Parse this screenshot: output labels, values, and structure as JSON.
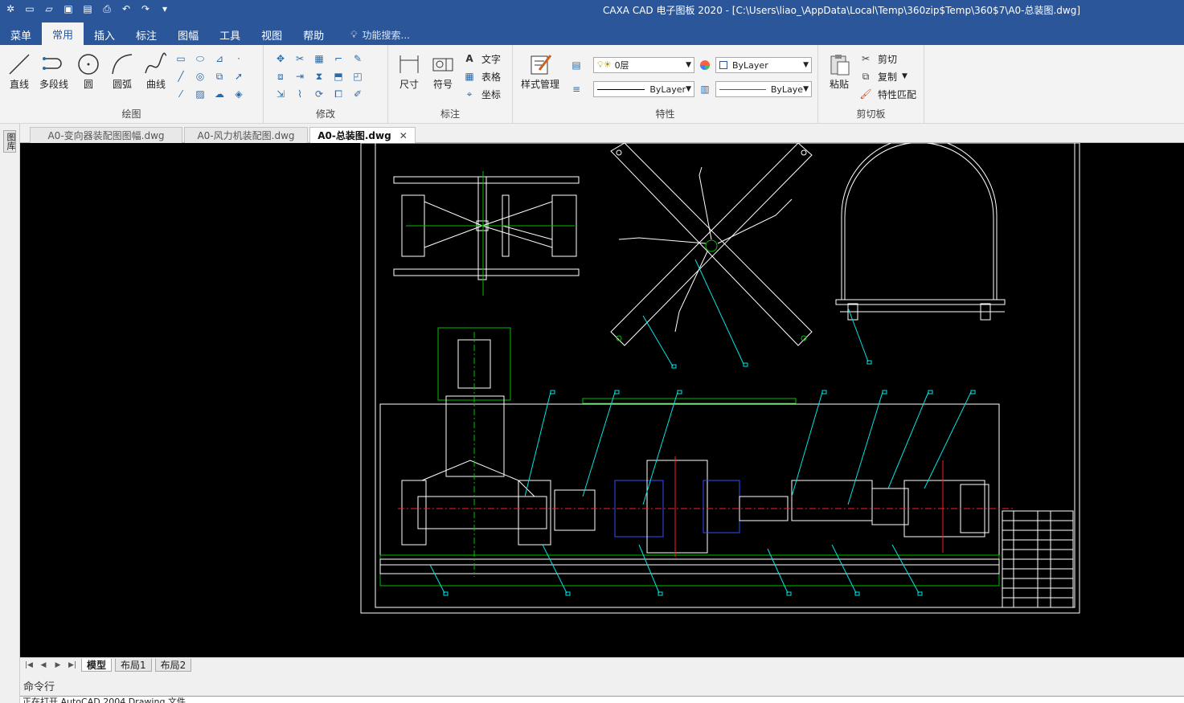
{
  "window": {
    "title": "CAXA CAD 电子图板 2020 - [C:\\Users\\liao_\\AppData\\Local\\Temp\\360zip$Temp\\360$7\\A0-总装图.dwg]"
  },
  "qat": {
    "icons": [
      "app-logo-icon",
      "new-file-icon",
      "open-folder-icon",
      "save-icon",
      "save-all-icon",
      "print-icon",
      "undo-icon",
      "redo-icon",
      "customize-icon"
    ]
  },
  "menu": {
    "tabs": [
      {
        "label": "菜单"
      },
      {
        "label": "常用"
      },
      {
        "label": "插入"
      },
      {
        "label": "标注"
      },
      {
        "label": "图幅"
      },
      {
        "label": "工具"
      },
      {
        "label": "视图"
      },
      {
        "label": "帮助"
      }
    ],
    "active_tab": "常用",
    "search_placeholder": "功能搜索..."
  },
  "ribbon": {
    "draw": {
      "label": "绘图",
      "buttons": [
        {
          "label": "直线"
        },
        {
          "label": "多段线"
        },
        {
          "label": "圆"
        },
        {
          "label": "圆弧"
        },
        {
          "label": "曲线"
        }
      ]
    },
    "modify": {
      "label": "修改"
    },
    "annotate": {
      "label": "标注",
      "buttons": [
        {
          "label": "尺寸"
        },
        {
          "label": "符号"
        }
      ],
      "small": [
        {
          "label": "文字"
        },
        {
          "label": "表格"
        },
        {
          "label": "坐标"
        }
      ]
    },
    "properties": {
      "label": "特性",
      "style_button": "样式管理",
      "layer_value": "0层",
      "color_value": "ByLayer",
      "linetype_value": "ByLayer",
      "lineweight_value": "ByLaye"
    },
    "clipboard": {
      "label": "剪切板",
      "paste": "粘贴",
      "cut": "剪切",
      "copy": "复制",
      "match": "特性匹配"
    }
  },
  "side_panel": {
    "label": "图库"
  },
  "doc_tabs": [
    {
      "label": "A0-变向器装配图图幅.dwg",
      "active": false
    },
    {
      "label": "A0-风力机装配图.dwg",
      "active": false
    },
    {
      "label": "A0-总装图.dwg",
      "active": true
    }
  ],
  "layout_tabs": [
    {
      "label": "模型",
      "active": true
    },
    {
      "label": "布局1",
      "active": false
    },
    {
      "label": "布局2",
      "active": false
    }
  ],
  "command": {
    "label": "命令行",
    "output": "正在打开 AutoCAD 2004 Drawing 文件"
  },
  "colors": {
    "titlebar": "#2b579a",
    "canvas_bg": "#000000",
    "drawing_white": "#ffffff",
    "drawing_green": "#00c000",
    "drawing_cyan": "#00e5e5",
    "drawing_red": "#ff2020",
    "drawing_blue": "#3050ff"
  }
}
